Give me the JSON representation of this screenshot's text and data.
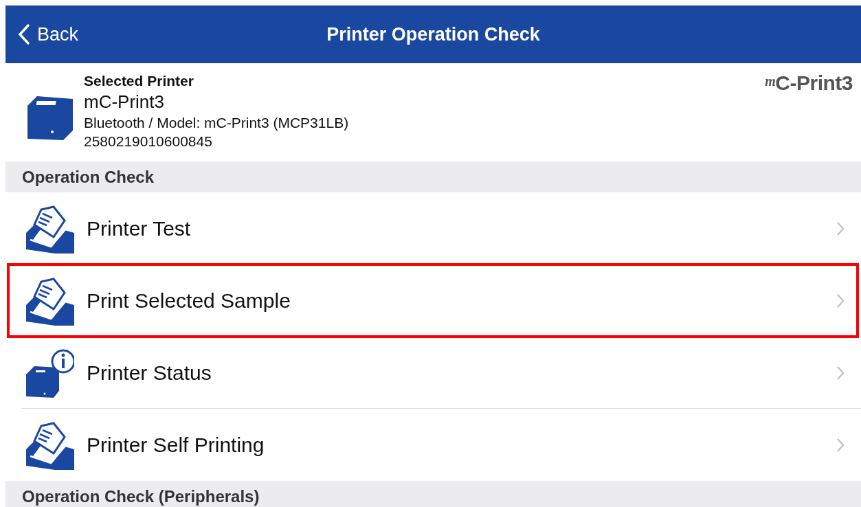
{
  "nav_bar": {
    "back_label": "Back",
    "title": "Printer Operation Check"
  },
  "selected_printer": {
    "heading": "Selected Printer",
    "name": "mC-Print3",
    "details": "Bluetooth / Model: mC-Print3 (MCP31LB)",
    "serial": "2580219010600845",
    "logo": {
      "mark": "m",
      "name": "C-Print3"
    }
  },
  "sections": [
    {
      "title": "Operation Check",
      "items": [
        {
          "label": "Printer Test",
          "kind": "print",
          "highlighted": false
        },
        {
          "label": "Print Selected Sample",
          "kind": "print",
          "highlighted": true
        },
        {
          "label": "Printer Status",
          "kind": "status",
          "highlighted": false
        },
        {
          "label": "Printer Self Printing",
          "kind": "print",
          "highlighted": false
        }
      ]
    },
    {
      "title": "Operation Check (Peripherals)"
    }
  ]
}
